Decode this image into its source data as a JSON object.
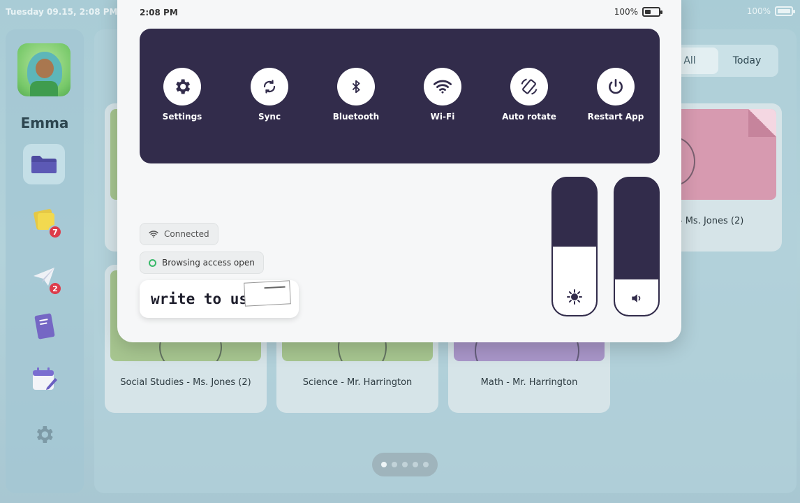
{
  "status_bar": {
    "datetime": "Tuesday 09.15, 2:08 PM",
    "battery": "100%"
  },
  "sidebar": {
    "username": "Emma",
    "items": [
      {
        "name": "folder",
        "icon": "folder-icon",
        "active": true
      },
      {
        "name": "notes",
        "icon": "sticky-note-icon",
        "badge": "7"
      },
      {
        "name": "messages",
        "icon": "paper-plane-icon",
        "badge": "2"
      },
      {
        "name": "notebook",
        "icon": "notebook-icon"
      },
      {
        "name": "calendar",
        "icon": "calendar-icon"
      },
      {
        "name": "settings",
        "icon": "gear-icon"
      }
    ]
  },
  "filter": {
    "all": "All",
    "today": "Today"
  },
  "cards": [
    {
      "label": "Arts - Ms. Jones (2)",
      "color": "#d79ab0"
    },
    {
      "label": "Social Studies - Ms. Jones (2)",
      "color": "#a7c690"
    },
    {
      "label": "Science - Mr. Harrington",
      "color": "#a7c690"
    },
    {
      "label": "Math - Mr. Harrington",
      "color": "#a996c9"
    }
  ],
  "quick_panel": {
    "time": "2:08 PM",
    "battery": "100%",
    "tiles": [
      {
        "label": "Settings",
        "icon": "gear-icon"
      },
      {
        "label": "Sync",
        "icon": "sync-icon"
      },
      {
        "label": "Bluetooth",
        "icon": "bluetooth-icon"
      },
      {
        "label": "Wi-Fi",
        "icon": "wifi-icon"
      },
      {
        "label": "Auto rotate",
        "icon": "auto-rotate-icon"
      },
      {
        "label": "Restart App",
        "icon": "power-icon"
      }
    ],
    "wifi_status": "Connected",
    "browsing_status": "Browsing access open",
    "write_to_us": "write to us",
    "brightness_level": 0.5,
    "volume_level": 0.26
  },
  "colors": {
    "panel_dark": "#322c4b",
    "accent_green": "#39b96a",
    "badge_red": "#dd3b4a"
  },
  "pager": {
    "pages": 5,
    "current": 1
  }
}
